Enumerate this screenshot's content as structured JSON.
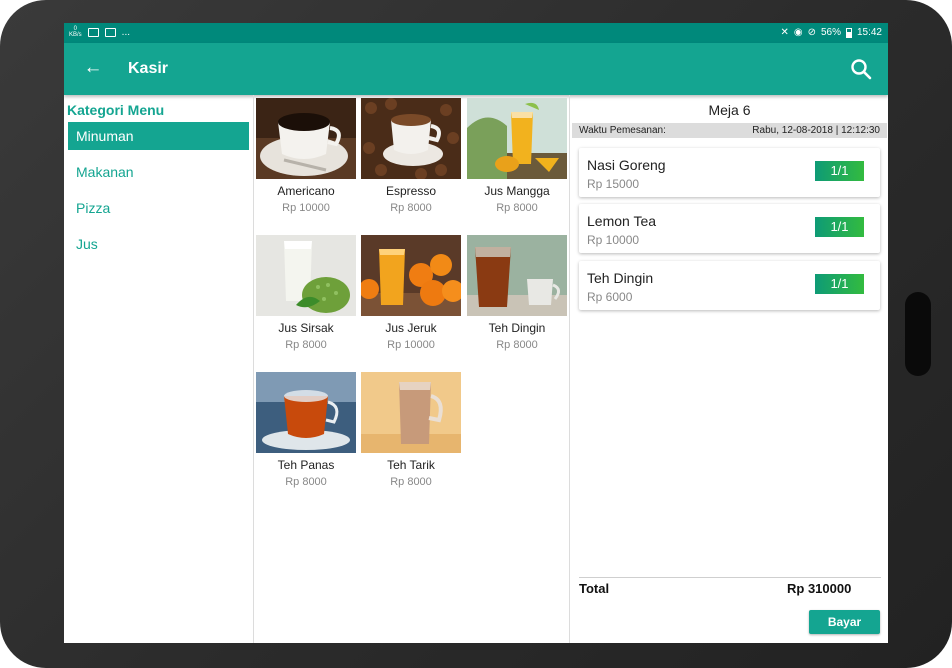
{
  "status_bar": {
    "net_speed_value": "0",
    "net_speed_unit": "KB/s",
    "overflow": "...",
    "battery": "56%",
    "time": "15:42"
  },
  "app_bar": {
    "title": "Kasir",
    "back_icon": "arrow-left",
    "search_icon": "search"
  },
  "categories": {
    "title": "Kategori Menu",
    "items": [
      {
        "label": "Minuman",
        "active": true
      },
      {
        "label": "Makanan",
        "active": false
      },
      {
        "label": "Pizza",
        "active": false
      },
      {
        "label": "Jus",
        "active": false
      }
    ]
  },
  "products": [
    {
      "name": "Americano",
      "price": "Rp 10000"
    },
    {
      "name": "Espresso",
      "price": "Rp 8000"
    },
    {
      "name": "Jus Mangga",
      "price": "Rp 8000"
    },
    {
      "name": "Jus Sirsak",
      "price": "Rp 8000"
    },
    {
      "name": "Jus Jeruk",
      "price": "Rp 10000"
    },
    {
      "name": "Teh Dingin",
      "price": "Rp 8000"
    },
    {
      "name": "Teh Panas",
      "price": "Rp 8000"
    },
    {
      "name": "Teh Tarik",
      "price": "Rp 8000"
    }
  ],
  "order": {
    "table": "Meja 6",
    "time_label": "Waktu Pemesanan:",
    "time_value": "Rabu, 12-08-2018 | 12:12:30",
    "items": [
      {
        "name": "Nasi Goreng",
        "price": "Rp 15000",
        "qty": "1/1"
      },
      {
        "name": "Lemon Tea",
        "price": "Rp 10000",
        "qty": "1/1"
      },
      {
        "name": "Teh Dingin",
        "price": "Rp 6000",
        "qty": "1/1"
      }
    ],
    "total_label": "Total",
    "total_value": "Rp 310000",
    "pay_label": "Bayar"
  },
  "colors": {
    "status_bar": "#00897b",
    "primary": "#14a591",
    "qty_gradient_start": "#0e9b76",
    "qty_gradient_end": "#33bb3f",
    "divider": "#dcdcdc"
  }
}
